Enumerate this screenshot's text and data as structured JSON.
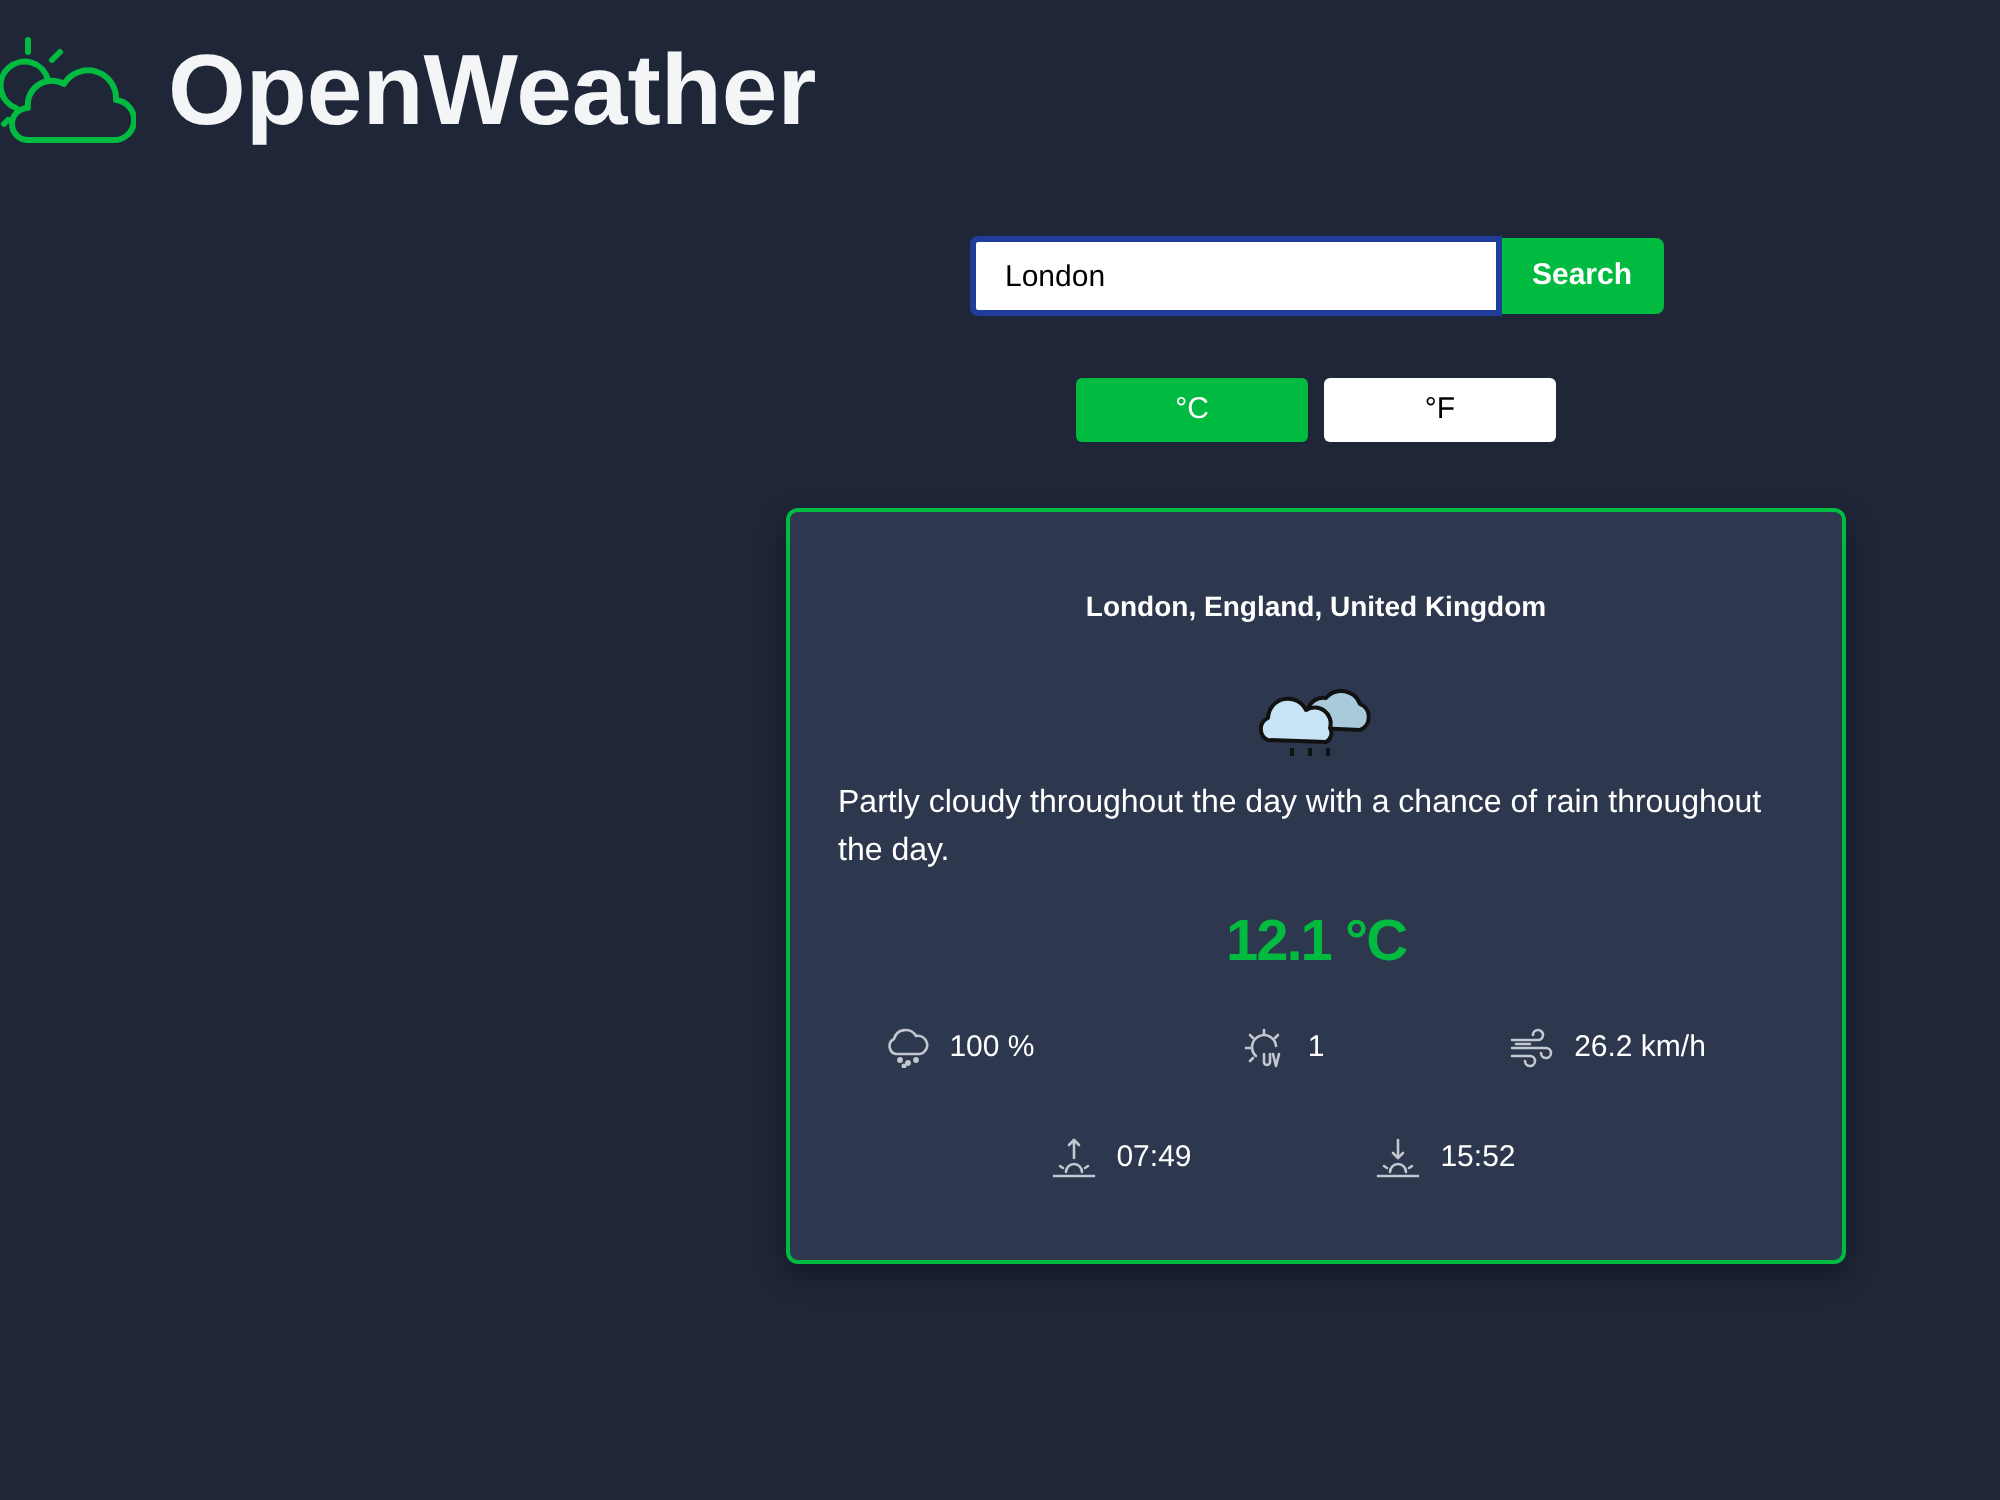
{
  "header": {
    "title": "OpenWeather"
  },
  "search": {
    "value": "London",
    "button": "Search"
  },
  "units": [
    {
      "label": "°C",
      "selected": true
    },
    {
      "label": "°F",
      "selected": false
    }
  ],
  "weather": {
    "location": "London, England, United Kingdom",
    "description": "Partly cloudy throughout the day with a chance of rain throughout the day.",
    "temperature": "12.1 °C",
    "stats": [
      {
        "kind": "precipitation",
        "value": "100 %"
      },
      {
        "kind": "uv",
        "value": "1"
      },
      {
        "kind": "wind",
        "value": "26.2 km/h"
      }
    ],
    "sun": [
      {
        "kind": "sunrise",
        "value": "07:49"
      },
      {
        "kind": "sunset",
        "value": "15:52"
      }
    ]
  }
}
